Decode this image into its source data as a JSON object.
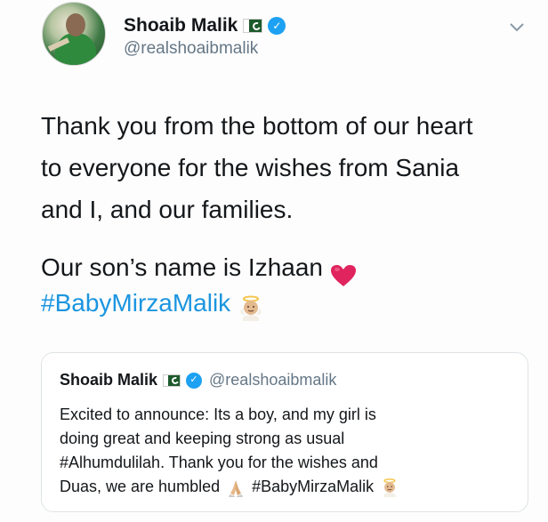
{
  "tweet": {
    "author": {
      "name": "Shoaib Malik",
      "handle": "@realshoaibmalik"
    },
    "text_lines": [
      "Thank you from the bottom of our heart",
      "to everyone for the wishes from Sania",
      "and I, and our families.",
      "Our son’s name is Izhaan",
      "#BabyMirzaMalik"
    ],
    "icons": {
      "flag": "pakistan-flag-icon",
      "verified": "verified-badge-icon",
      "menu": "chevron-down-icon",
      "heart": "red-heart-emoji",
      "angel": "baby-angel-emoji"
    },
    "colors": {
      "hashtag": "#1b95e0",
      "verified": "#1da1f2",
      "handle": "#657786",
      "heart": "#e0245e"
    }
  },
  "quoted_tweet": {
    "author": {
      "name": "Shoaib Malik",
      "handle": "@realshoaibmalik"
    },
    "lines": {
      "l1": "Excited to announce: Its a boy, and my girl is",
      "l2": "doing great and keeping strong as usual",
      "l3": "#Alhumdulilah. Thank you for the wishes and",
      "l4a": "Duas, we are humbled",
      "l4b": "#BabyMirzaMalik"
    },
    "icons": {
      "pray": "folded-hands-emoji",
      "angel": "baby-angel-emoji"
    }
  }
}
